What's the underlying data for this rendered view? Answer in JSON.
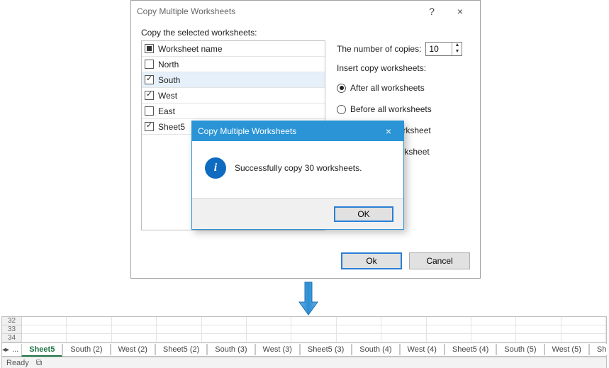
{
  "dialog": {
    "title": "Copy Multiple Worksheets",
    "help_icon": "?",
    "close_icon": "×",
    "section_label": "Copy the selected worksheets:",
    "header_label": "Worksheet name",
    "worksheets": [
      {
        "name": "North",
        "checked": false,
        "selected": false
      },
      {
        "name": "South",
        "checked": true,
        "selected": true
      },
      {
        "name": "West",
        "checked": true,
        "selected": false
      },
      {
        "name": "East",
        "checked": false,
        "selected": false
      },
      {
        "name": "Sheet5",
        "checked": true,
        "selected": false
      }
    ],
    "copies_label": "The number of copies:",
    "copies_value": "10",
    "insert_label": "Insert copy worksheets:",
    "radio_options": [
      {
        "label": "After all worksheets",
        "checked": true
      },
      {
        "label": "Before all worksheets",
        "checked": false
      },
      {
        "label": "After current worksheet",
        "checked": false,
        "clipped": "ent worksheet"
      },
      {
        "label": "Before current worksheet",
        "checked": false,
        "clipped": "rrent worksheet"
      }
    ],
    "ok": "Ok",
    "cancel": "Cancel"
  },
  "msgbox": {
    "title": "Copy Multiple Worksheets",
    "close_icon": "×",
    "info_glyph": "i",
    "message": "Successfully copy 30 worksheets.",
    "ok": "OK"
  },
  "sheet": {
    "rows": [
      "32",
      "33",
      "34"
    ],
    "nav_left": "◂",
    "nav_right": "▸",
    "overflow_left": "...",
    "tabs": [
      {
        "label": "Sheet5",
        "active": true
      },
      {
        "label": "South (2)"
      },
      {
        "label": "West (2)"
      },
      {
        "label": "Sheet5 (2)"
      },
      {
        "label": "South (3)"
      },
      {
        "label": "West (3)"
      },
      {
        "label": "Sheet5 (3)"
      },
      {
        "label": "South (4)"
      },
      {
        "label": "West (4)"
      },
      {
        "label": "Sheet5 (4)"
      },
      {
        "label": "South (5)"
      },
      {
        "label": "West (5)"
      },
      {
        "label": "Sh"
      }
    ],
    "overflow_right": "...",
    "new_sheet": "⊕",
    "status": "Ready",
    "macro_icon": "⧉"
  }
}
